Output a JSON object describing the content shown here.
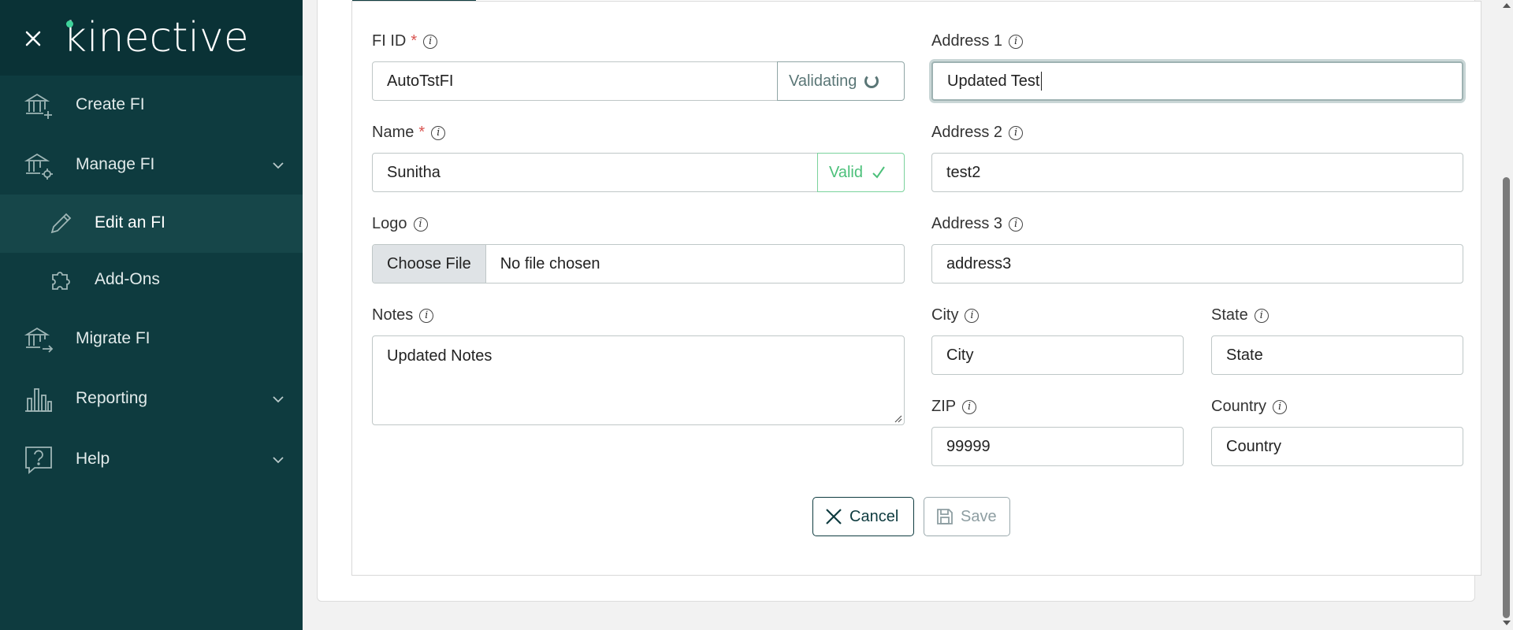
{
  "sidebar": {
    "logo_text": "kinective",
    "items": [
      {
        "label": "Create FI",
        "icon": "bank-plus-icon"
      },
      {
        "label": "Manage FI",
        "icon": "bank-gear-icon"
      },
      {
        "label": "Edit an FI",
        "icon": "pencil-icon"
      },
      {
        "label": "Add-Ons",
        "icon": "puzzle-icon"
      },
      {
        "label": "Migrate FI",
        "icon": "bank-arrow-icon"
      },
      {
        "label": "Reporting",
        "icon": "bar-chart-icon"
      },
      {
        "label": "Help",
        "icon": "help-icon"
      }
    ]
  },
  "form": {
    "fi_id": {
      "label": "FI ID",
      "required": "*",
      "value": "AutoTstFI",
      "status": "Validating"
    },
    "name": {
      "label": "Name",
      "required": "*",
      "value": "Sunitha",
      "status": "Valid"
    },
    "logo": {
      "label": "Logo",
      "button": "Choose File",
      "file_text": "No file chosen"
    },
    "notes": {
      "label": "Notes",
      "value": "Updated Notes"
    },
    "address1": {
      "label": "Address 1",
      "value": "Updated Test"
    },
    "address2": {
      "label": "Address 2",
      "value": "test2"
    },
    "address3": {
      "label": "Address 3",
      "value": "address3"
    },
    "city": {
      "label": "City",
      "placeholder": "City"
    },
    "state": {
      "label": "State",
      "placeholder": "State"
    },
    "zip": {
      "label": "ZIP",
      "value": "99999"
    },
    "country": {
      "label": "Country",
      "placeholder": "Country"
    }
  },
  "buttons": {
    "cancel": "Cancel",
    "save": "Save"
  },
  "colors": {
    "sidebar": "#0e3b3f",
    "valid": "#4cc07a",
    "required": "#d9534f"
  }
}
